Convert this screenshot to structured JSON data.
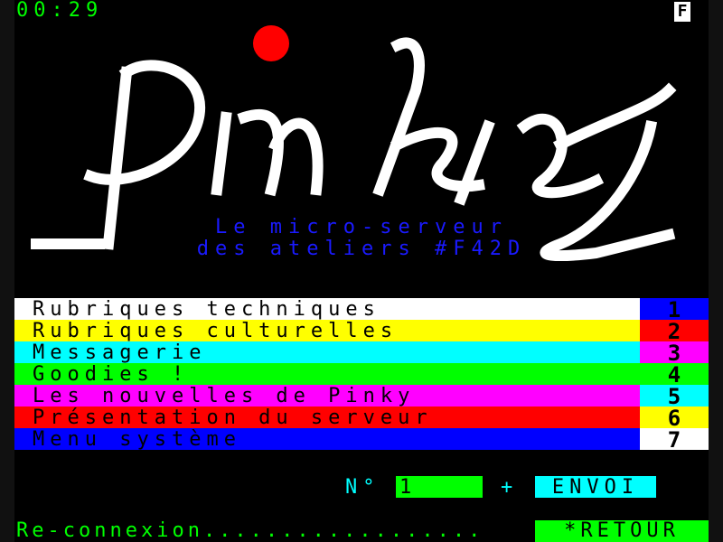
{
  "header": {
    "timer": "00:29",
    "badge": "F"
  },
  "logo": {
    "text": "pinky"
  },
  "tagline": {
    "line1": "Le micro-serveur",
    "line2": "des ateliers #F42D"
  },
  "menu": {
    "items": [
      {
        "label": "Rubriques techniques",
        "num": "1",
        "bg": "#ffffff",
        "num_bg": "#0000ff"
      },
      {
        "label": "Rubriques culturelles",
        "num": "2",
        "bg": "#ffff00",
        "num_bg": "#ff0000"
      },
      {
        "label": "Messagerie",
        "num": "3",
        "bg": "#00ffff",
        "num_bg": "#ff00ff"
      },
      {
        "label": "Goodies !",
        "num": "4",
        "bg": "#00ff00",
        "num_bg": "#00ff00"
      },
      {
        "label": "Les nouvelles de Pinky",
        "num": "5",
        "bg": "#ff00ff",
        "num_bg": "#00ffff"
      },
      {
        "label": "Présentation du serveur",
        "num": "6",
        "bg": "#ff0000",
        "num_bg": "#ffff00"
      },
      {
        "label": "Menu système",
        "num": "7",
        "bg": "#0000ff",
        "num_bg": "#ffffff"
      }
    ]
  },
  "entry": {
    "label": "N°",
    "value": "1",
    "plus": "+",
    "send": "ENVOI"
  },
  "footer": {
    "reconnect": "Re-connexion..................",
    "back": "*RETOUR"
  },
  "colors": {
    "bg": "#000000",
    "accent": "#00ff00",
    "cyan": "#00ffff",
    "logo_dot": "#ff0000"
  }
}
